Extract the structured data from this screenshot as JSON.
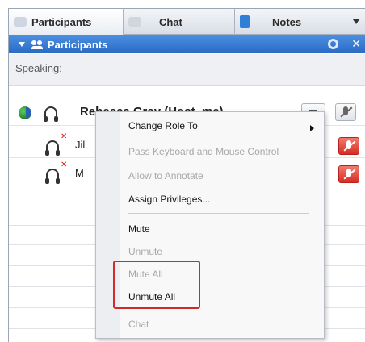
{
  "tabs": [
    {
      "label": "Participants",
      "icon": "participants-icon"
    },
    {
      "label": "Chat",
      "icon": "chat-icon"
    },
    {
      "label": "Notes",
      "icon": "notes-icon"
    }
  ],
  "panel": {
    "title": "Participants",
    "speaking_label": "Speaking:"
  },
  "participants": [
    {
      "name": "Rebecca Gray (Host, me)",
      "status": "connected"
    },
    {
      "name": "Jil",
      "status": "muted"
    },
    {
      "name": "M",
      "status": "muted"
    }
  ],
  "context_menu": {
    "items": [
      {
        "label": "Change Role To",
        "disabled": false,
        "submenu": true
      },
      {
        "label": "Pass Keyboard and Mouse Control",
        "disabled": true
      },
      {
        "label": "Allow to Annotate",
        "disabled": true
      },
      {
        "label": "Assign Privileges...",
        "disabled": false
      },
      {
        "label": "Mute",
        "disabled": false
      },
      {
        "label": "Unmute",
        "disabled": true
      },
      {
        "label": "Mute All",
        "disabled": true
      },
      {
        "label": "Unmute All",
        "disabled": false
      },
      {
        "label": "Chat",
        "disabled": true
      }
    ]
  },
  "colors": {
    "header_blue": "#2a6bc4",
    "highlight_red": "#d12a2a",
    "mute_red": "#d62d23"
  }
}
